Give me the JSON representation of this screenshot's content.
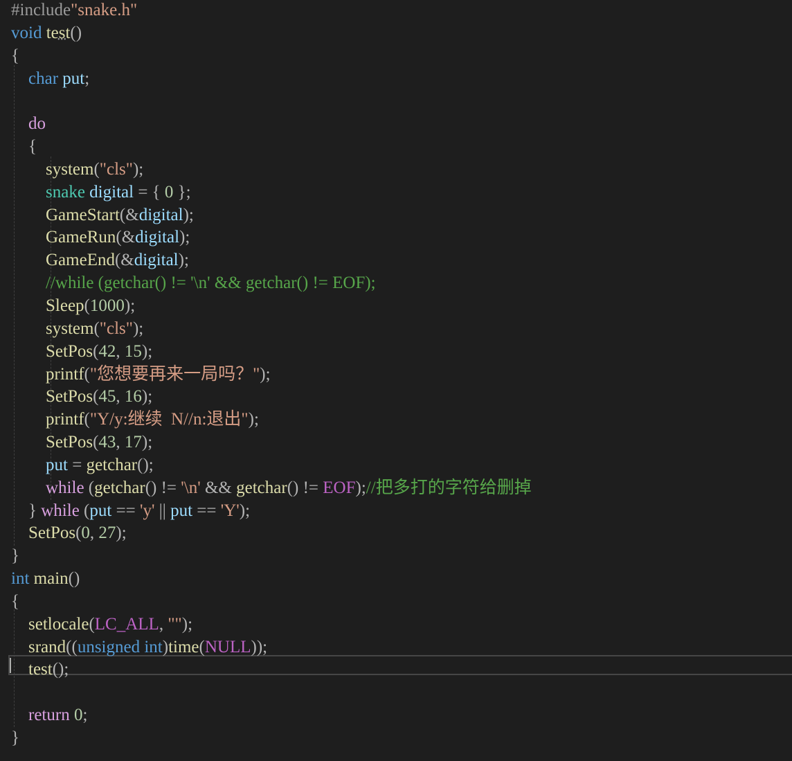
{
  "editor": {
    "lines": [
      [
        {
          "t": "#include",
          "c": "preproc"
        },
        {
          "t": "\"snake.h\"",
          "c": "include-str"
        }
      ],
      [
        {
          "t": "void",
          "c": "kw"
        },
        {
          "t": " ",
          "c": "plain"
        },
        {
          "t": "test",
          "c": "fn"
        },
        {
          "t": "()",
          "c": "punc"
        }
      ],
      [
        {
          "t": "{",
          "c": "punc"
        }
      ],
      [
        {
          "t": "    ",
          "c": "plain"
        },
        {
          "t": "char",
          "c": "kw"
        },
        {
          "t": " ",
          "c": "plain"
        },
        {
          "t": "put",
          "c": "var"
        },
        {
          "t": ";",
          "c": "punc"
        }
      ],
      [],
      [
        {
          "t": "    ",
          "c": "plain"
        },
        {
          "t": "do",
          "c": "ctrl"
        }
      ],
      [
        {
          "t": "    ",
          "c": "plain"
        },
        {
          "t": "{",
          "c": "punc"
        }
      ],
      [
        {
          "t": "        ",
          "c": "plain"
        },
        {
          "t": "system",
          "c": "fn"
        },
        {
          "t": "(",
          "c": "punc"
        },
        {
          "t": "\"cls\"",
          "c": "str"
        },
        {
          "t": ");",
          "c": "punc"
        }
      ],
      [
        {
          "t": "        ",
          "c": "plain"
        },
        {
          "t": "snake",
          "c": "type"
        },
        {
          "t": " ",
          "c": "plain"
        },
        {
          "t": "digital",
          "c": "var"
        },
        {
          "t": " = { ",
          "c": "punc"
        },
        {
          "t": "0",
          "c": "num"
        },
        {
          "t": " };",
          "c": "punc"
        }
      ],
      [
        {
          "t": "        ",
          "c": "plain"
        },
        {
          "t": "GameStart",
          "c": "fn"
        },
        {
          "t": "(&",
          "c": "punc"
        },
        {
          "t": "digital",
          "c": "var"
        },
        {
          "t": ");",
          "c": "punc"
        }
      ],
      [
        {
          "t": "        ",
          "c": "plain"
        },
        {
          "t": "GameRun",
          "c": "fn"
        },
        {
          "t": "(&",
          "c": "punc"
        },
        {
          "t": "digital",
          "c": "var"
        },
        {
          "t": ");",
          "c": "punc"
        }
      ],
      [
        {
          "t": "        ",
          "c": "plain"
        },
        {
          "t": "GameEnd",
          "c": "fn"
        },
        {
          "t": "(&",
          "c": "punc"
        },
        {
          "t": "digital",
          "c": "var"
        },
        {
          "t": ");",
          "c": "punc"
        }
      ],
      [
        {
          "t": "        ",
          "c": "plain"
        },
        {
          "t": "//while (getchar() != '\\n' && getchar() != EOF);",
          "c": "comment"
        }
      ],
      [
        {
          "t": "        ",
          "c": "plain"
        },
        {
          "t": "Sleep",
          "c": "fn"
        },
        {
          "t": "(",
          "c": "punc"
        },
        {
          "t": "1000",
          "c": "num"
        },
        {
          "t": ");",
          "c": "punc"
        }
      ],
      [
        {
          "t": "        ",
          "c": "plain"
        },
        {
          "t": "system",
          "c": "fn"
        },
        {
          "t": "(",
          "c": "punc"
        },
        {
          "t": "\"cls\"",
          "c": "str"
        },
        {
          "t": ");",
          "c": "punc"
        }
      ],
      [
        {
          "t": "        ",
          "c": "plain"
        },
        {
          "t": "SetPos",
          "c": "fn"
        },
        {
          "t": "(",
          "c": "punc"
        },
        {
          "t": "42",
          "c": "num"
        },
        {
          "t": ", ",
          "c": "punc"
        },
        {
          "t": "15",
          "c": "num"
        },
        {
          "t": ");",
          "c": "punc"
        }
      ],
      [
        {
          "t": "        ",
          "c": "plain"
        },
        {
          "t": "printf",
          "c": "fn"
        },
        {
          "t": "(",
          "c": "punc"
        },
        {
          "t": "\"您想要再来一局吗？\"",
          "c": "str"
        },
        {
          "t": ");",
          "c": "punc"
        }
      ],
      [
        {
          "t": "        ",
          "c": "plain"
        },
        {
          "t": "SetPos",
          "c": "fn"
        },
        {
          "t": "(",
          "c": "punc"
        },
        {
          "t": "45",
          "c": "num"
        },
        {
          "t": ", ",
          "c": "punc"
        },
        {
          "t": "16",
          "c": "num"
        },
        {
          "t": ");",
          "c": "punc"
        }
      ],
      [
        {
          "t": "        ",
          "c": "plain"
        },
        {
          "t": "printf",
          "c": "fn"
        },
        {
          "t": "(",
          "c": "punc"
        },
        {
          "t": "\"Y/y:继续  N//n:退出\"",
          "c": "str"
        },
        {
          "t": ");",
          "c": "punc"
        }
      ],
      [
        {
          "t": "        ",
          "c": "plain"
        },
        {
          "t": "SetPos",
          "c": "fn"
        },
        {
          "t": "(",
          "c": "punc"
        },
        {
          "t": "43",
          "c": "num"
        },
        {
          "t": ", ",
          "c": "punc"
        },
        {
          "t": "17",
          "c": "num"
        },
        {
          "t": ");",
          "c": "punc"
        }
      ],
      [
        {
          "t": "        ",
          "c": "plain"
        },
        {
          "t": "put",
          "c": "var"
        },
        {
          "t": " = ",
          "c": "punc"
        },
        {
          "t": "getchar",
          "c": "fn"
        },
        {
          "t": "();",
          "c": "punc"
        }
      ],
      [
        {
          "t": "        ",
          "c": "plain"
        },
        {
          "t": "while",
          "c": "ctrl"
        },
        {
          "t": " (",
          "c": "punc"
        },
        {
          "t": "getchar",
          "c": "fn"
        },
        {
          "t": "() != ",
          "c": "punc"
        },
        {
          "t": "'\\n'",
          "c": "str"
        },
        {
          "t": " && ",
          "c": "punc"
        },
        {
          "t": "getchar",
          "c": "fn"
        },
        {
          "t": "() != ",
          "c": "punc"
        },
        {
          "t": "EOF",
          "c": "macro"
        },
        {
          "t": ");",
          "c": "punc"
        },
        {
          "t": "//把多打的字符给删掉",
          "c": "comment"
        }
      ],
      [
        {
          "t": "    ",
          "c": "plain"
        },
        {
          "t": "} ",
          "c": "punc"
        },
        {
          "t": "while",
          "c": "ctrl"
        },
        {
          "t": " (",
          "c": "punc"
        },
        {
          "t": "put",
          "c": "var"
        },
        {
          "t": " == ",
          "c": "punc"
        },
        {
          "t": "'y'",
          "c": "str"
        },
        {
          "t": " || ",
          "c": "punc"
        },
        {
          "t": "put",
          "c": "var"
        },
        {
          "t": " == ",
          "c": "punc"
        },
        {
          "t": "'Y'",
          "c": "str"
        },
        {
          "t": ");",
          "c": "punc"
        }
      ],
      [
        {
          "t": "    ",
          "c": "plain"
        },
        {
          "t": "SetPos",
          "c": "fn"
        },
        {
          "t": "(",
          "c": "punc"
        },
        {
          "t": "0",
          "c": "num"
        },
        {
          "t": ", ",
          "c": "punc"
        },
        {
          "t": "27",
          "c": "num"
        },
        {
          "t": ");",
          "c": "punc"
        }
      ],
      [
        {
          "t": "}",
          "c": "punc"
        }
      ],
      [
        {
          "t": "int",
          "c": "kw"
        },
        {
          "t": " ",
          "c": "plain"
        },
        {
          "t": "main",
          "c": "fn"
        },
        {
          "t": "()",
          "c": "punc"
        }
      ],
      [
        {
          "t": "{",
          "c": "punc"
        }
      ],
      [
        {
          "t": "    ",
          "c": "plain"
        },
        {
          "t": "setlocale",
          "c": "fn"
        },
        {
          "t": "(",
          "c": "punc"
        },
        {
          "t": "LC_ALL",
          "c": "macro"
        },
        {
          "t": ", ",
          "c": "punc"
        },
        {
          "t": "\"\"",
          "c": "str"
        },
        {
          "t": ");",
          "c": "punc"
        }
      ],
      [
        {
          "t": "    ",
          "c": "plain"
        },
        {
          "t": "srand",
          "c": "fn"
        },
        {
          "t": "((",
          "c": "punc"
        },
        {
          "t": "unsigned",
          "c": "kw"
        },
        {
          "t": " ",
          "c": "plain"
        },
        {
          "t": "int",
          "c": "kw"
        },
        {
          "t": ")",
          "c": "punc"
        },
        {
          "t": "time",
          "c": "fn"
        },
        {
          "t": "(",
          "c": "punc"
        },
        {
          "t": "NULL",
          "c": "macro"
        },
        {
          "t": "));",
          "c": "punc"
        }
      ],
      [
        {
          "t": "    ",
          "c": "plain"
        },
        {
          "t": "test",
          "c": "fn"
        },
        {
          "t": "();",
          "c": "punc"
        }
      ],
      [],
      [
        {
          "t": "    ",
          "c": "plain"
        },
        {
          "t": "return",
          "c": "ctrl"
        },
        {
          "t": " ",
          "c": "plain"
        },
        {
          "t": "0",
          "c": "num"
        },
        {
          "t": ";",
          "c": "punc"
        }
      ],
      [
        {
          "t": "}",
          "c": "punc"
        }
      ]
    ],
    "colors": {
      "background": "#1e1e1e",
      "keyword": "#569cd6",
      "control": "#d8a0df",
      "type": "#4ec9b0",
      "variable": "#9cdcfe",
      "function": "#dcdcaa",
      "string": "#d69d85",
      "number": "#b5cea8",
      "comment": "#57a64a",
      "macro": "#bd63c5",
      "current_line_border": "#464646"
    }
  }
}
